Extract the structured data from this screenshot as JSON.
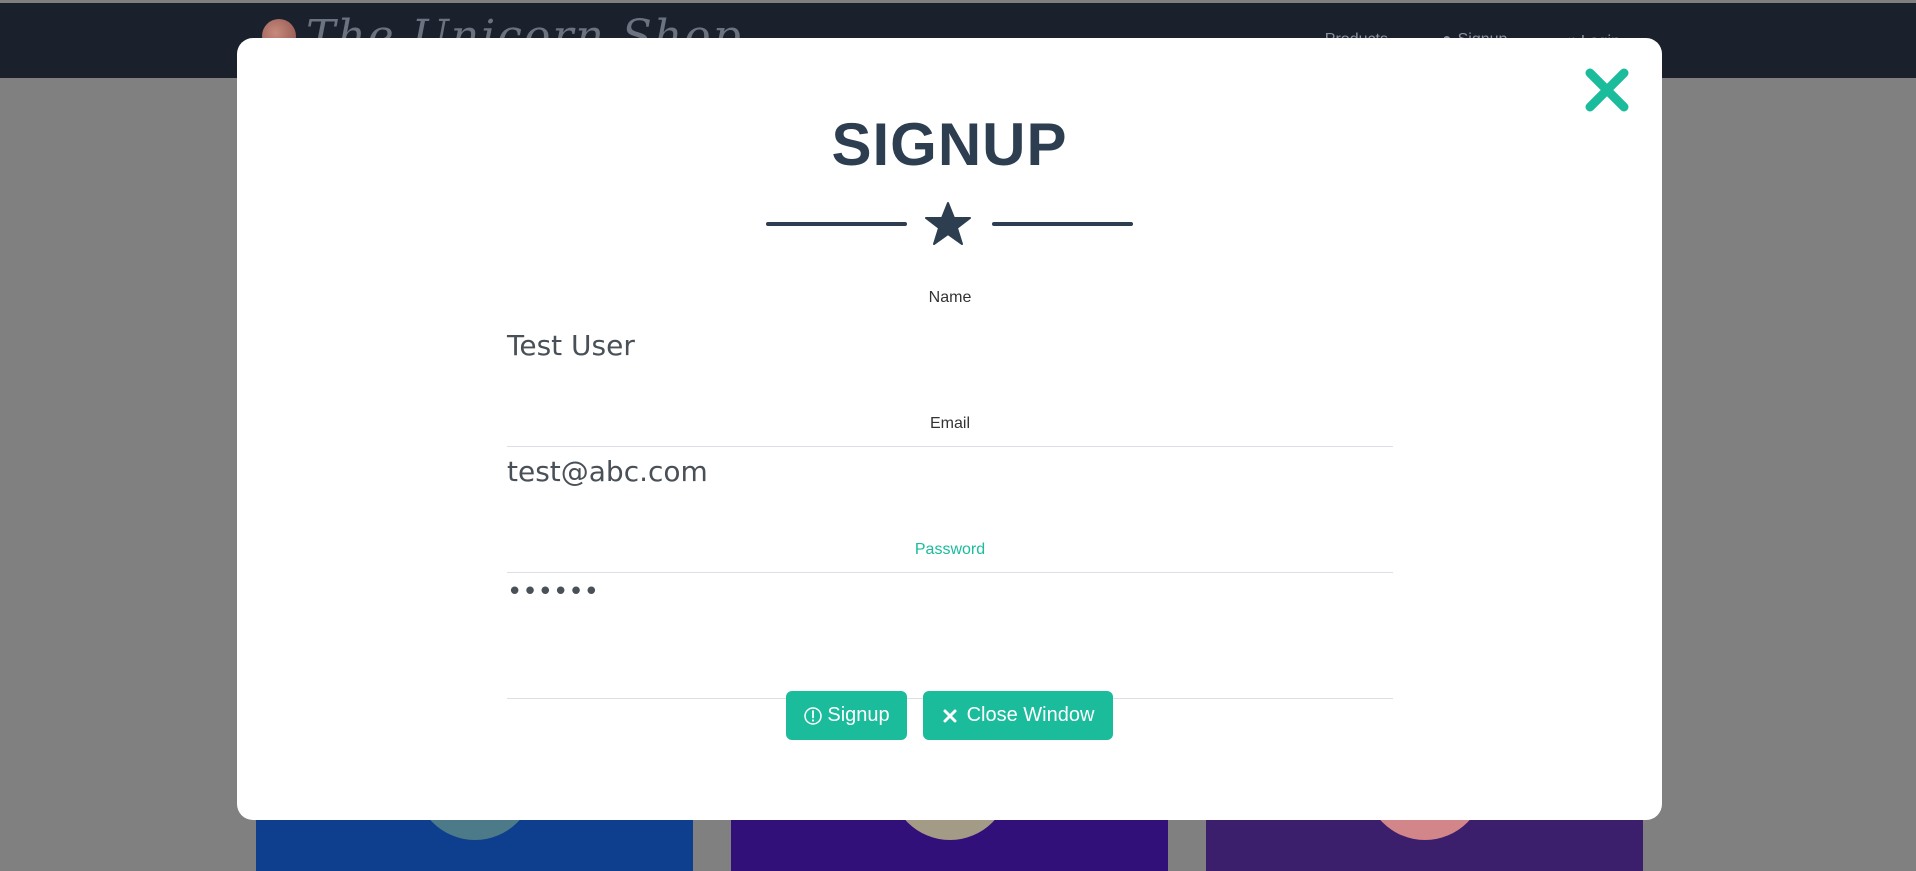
{
  "navbar": {
    "brand_text": "The Unicorn Shop",
    "links": [
      {
        "label": "Products",
        "icon": "none"
      },
      {
        "label": "Signup",
        "icon": "user-icon"
      },
      {
        "label": "Login",
        "icon": "login-icon"
      }
    ]
  },
  "modal": {
    "title": "SIGNUP",
    "close_icon": "close-icon",
    "divider_icon": "star-icon",
    "fields": {
      "name": {
        "label": "Name",
        "value": "Test User"
      },
      "email": {
        "label": "Email",
        "value": "test@abc.com"
      },
      "password": {
        "label": "Password",
        "value": "••••••"
      }
    },
    "buttons": {
      "signup_label": "Signup",
      "signup_icon": "info-circle-icon",
      "close_label": "Close Window",
      "close_icon": "close-icon"
    }
  },
  "colors": {
    "accent": "#1abc9c",
    "title": "#2c3e50",
    "navbar": "#1a202c",
    "overlay": "#808080"
  }
}
